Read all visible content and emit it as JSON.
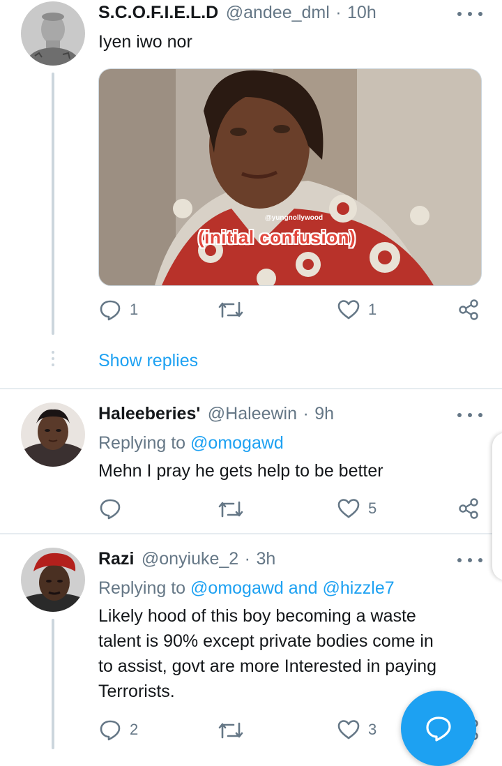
{
  "tweets": [
    {
      "name": "S.C.O.F.I.E.L.D",
      "handle": "@andee_dml",
      "separator": "·",
      "time": "10h",
      "text": "Iyen iwo nor",
      "media": {
        "watermark": "@yungnollywood",
        "caption": "(initial confusion)"
      },
      "replies": "1",
      "retweets": "",
      "likes": "1",
      "show_replies": "Show replies"
    },
    {
      "name": "Haleeberies'",
      "handle": "@Haleewin",
      "separator": "·",
      "time": "9h",
      "replying_prefix": "Replying to",
      "replying_to": "@omogawd",
      "text": "Mehn I pray he gets help to be better",
      "replies": "",
      "retweets": "",
      "likes": "5"
    },
    {
      "name": "Razi",
      "handle": "@onyiuke_2",
      "separator": "·",
      "time": "3h",
      "replying_prefix": "Replying to",
      "replying_to": "@omogawd",
      "replying_and": "and",
      "replying_to_2": "@hizzle7",
      "text_lines": [
        "Likely hood of this boy becoming a waste",
        "talent is 90% except private bodies come in",
        "to assist, govt are more Interested in paying",
        "Terrorists."
      ],
      "replies": "2",
      "retweets": "",
      "likes": "3"
    }
  ],
  "colors": {
    "accent": "#1da1f2",
    "secondary_text": "#657786",
    "thread_line": "#ccd6dd",
    "divider": "#e6ecf0"
  },
  "icons": [
    "reply-icon",
    "retweet-icon",
    "like-icon",
    "share-icon",
    "more-icon",
    "compose-message-icon"
  ]
}
